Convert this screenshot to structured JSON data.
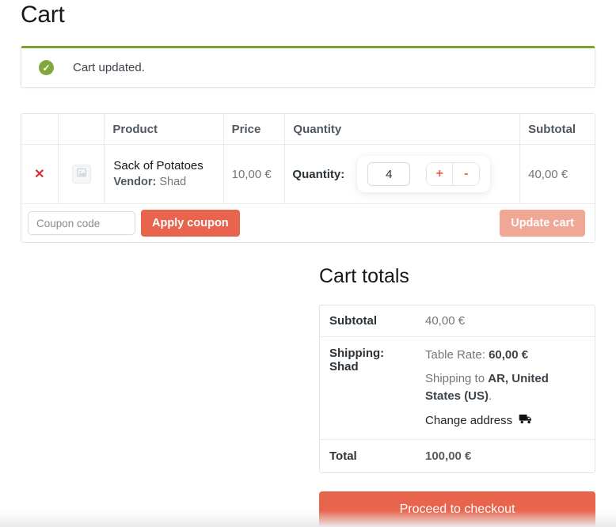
{
  "page": {
    "title": "Cart"
  },
  "icons": {
    "check": "✓",
    "remove": "✕",
    "plus": "+",
    "minus": "-"
  },
  "notice": {
    "message": "Cart updated."
  },
  "cart_table": {
    "headers": {
      "product": "Product",
      "price": "Price",
      "quantity": "Quantity",
      "subtotal": "Subtotal"
    },
    "items": [
      {
        "name": "Sack of Potatoes",
        "vendor_label": "Vendor:",
        "vendor": "Shad",
        "price": "10,00 €",
        "quantity_label": "Quantity:",
        "quantity": "4",
        "subtotal": "40,00 €"
      }
    ],
    "coupon": {
      "placeholder": "Coupon code",
      "apply_label": "Apply coupon",
      "update_label": "Update cart"
    }
  },
  "totals": {
    "title": "Cart totals",
    "subtotal_label": "Subtotal",
    "subtotal_value": "40,00 €",
    "shipping_label_line1": "Shipping:",
    "shipping_label_line2": "Shad",
    "shipping_method_label": "Table Rate:",
    "shipping_cost": "60,00 €",
    "shipping_to_prefix": "Shipping to ",
    "shipping_destination": "AR, United States (US)",
    "shipping_to_suffix": ".",
    "change_address_label": "Change address",
    "total_label": "Total",
    "total_value": "100,00 €",
    "checkout_label": "Proceed to checkout"
  },
  "colors": {
    "accent": "#e8644d",
    "accent_disabled": "#f0a795",
    "notice_green": "#7ca234",
    "remove_red": "#d32d35"
  }
}
